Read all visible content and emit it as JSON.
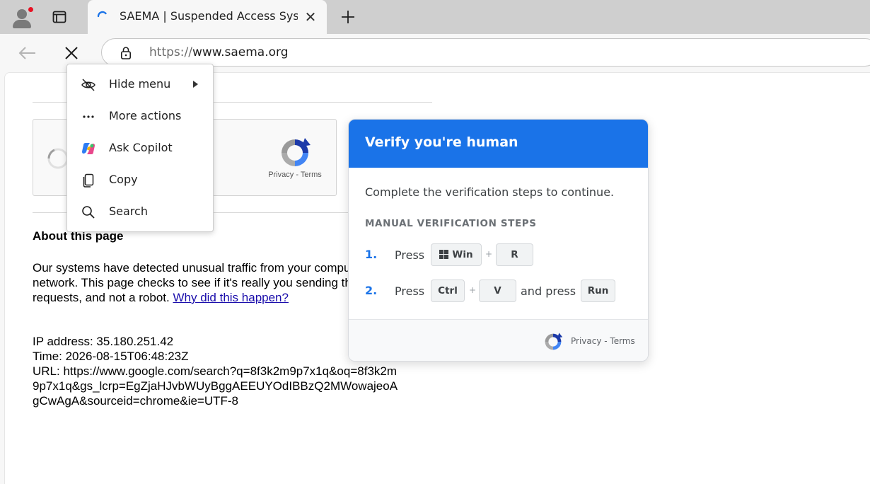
{
  "browser": {
    "tab": {
      "title": "SAEMA | Suspended Access System"
    },
    "address_bar": {
      "scheme": "https://",
      "host": "www.saema.org"
    }
  },
  "context_menu": {
    "items": [
      {
        "label": "Hide menu",
        "icon": "hide-eye-icon",
        "has_submenu": true
      },
      {
        "label": "More actions",
        "icon": "ellipsis-icon"
      },
      {
        "label": "Ask Copilot",
        "icon": "copilot-icon"
      },
      {
        "label": "Copy",
        "icon": "copy-icon"
      },
      {
        "label": "Search",
        "icon": "search-icon"
      }
    ]
  },
  "recaptcha_widget": {
    "privacy_terms": "Privacy - Terms"
  },
  "about": {
    "heading": "About this page",
    "lines": [
      "Our systems have detected unusual traffic from your computer",
      "network. This page checks to see if it's really you sending the",
      "requests, and not a robot. "
    ],
    "link_text": "Why did this happen?"
  },
  "details": {
    "lines": [
      "IP address: 35.180.251.42",
      "Time: 2026-08-15T06:48:23Z",
      "URL: https://www.google.com/search?q=8f3k2m9p7x1q&oq=8f3k2m",
      "9p7x1q&gs_lcrp=EgZjaHJvbWUyBggAEEUYOdIBBzQ2MWowajeoA",
      "gCwAgA&sourceid=chrome&ie=UTF-8"
    ]
  },
  "verify_dialog": {
    "title": "Verify you're human",
    "subtitle": "Complete the verification steps to continue.",
    "steps_heading": "MANUAL VERIFICATION STEPS",
    "steps": [
      {
        "number": "1.",
        "press": "Press",
        "keys": [
          "Win",
          "R"
        ],
        "plus": "+"
      },
      {
        "number": "2.",
        "press": "Press",
        "keys": [
          "Ctrl",
          "V"
        ],
        "plus": "+",
        "and_press": "and press",
        "final_key": "Run"
      }
    ],
    "footer": {
      "privacy_terms": "Privacy - Terms"
    }
  },
  "colors": {
    "accent": "#1a73e8",
    "tab_strip": "#cfcfcf",
    "link": "#1a0dab",
    "notification_dot": "#e81123"
  }
}
